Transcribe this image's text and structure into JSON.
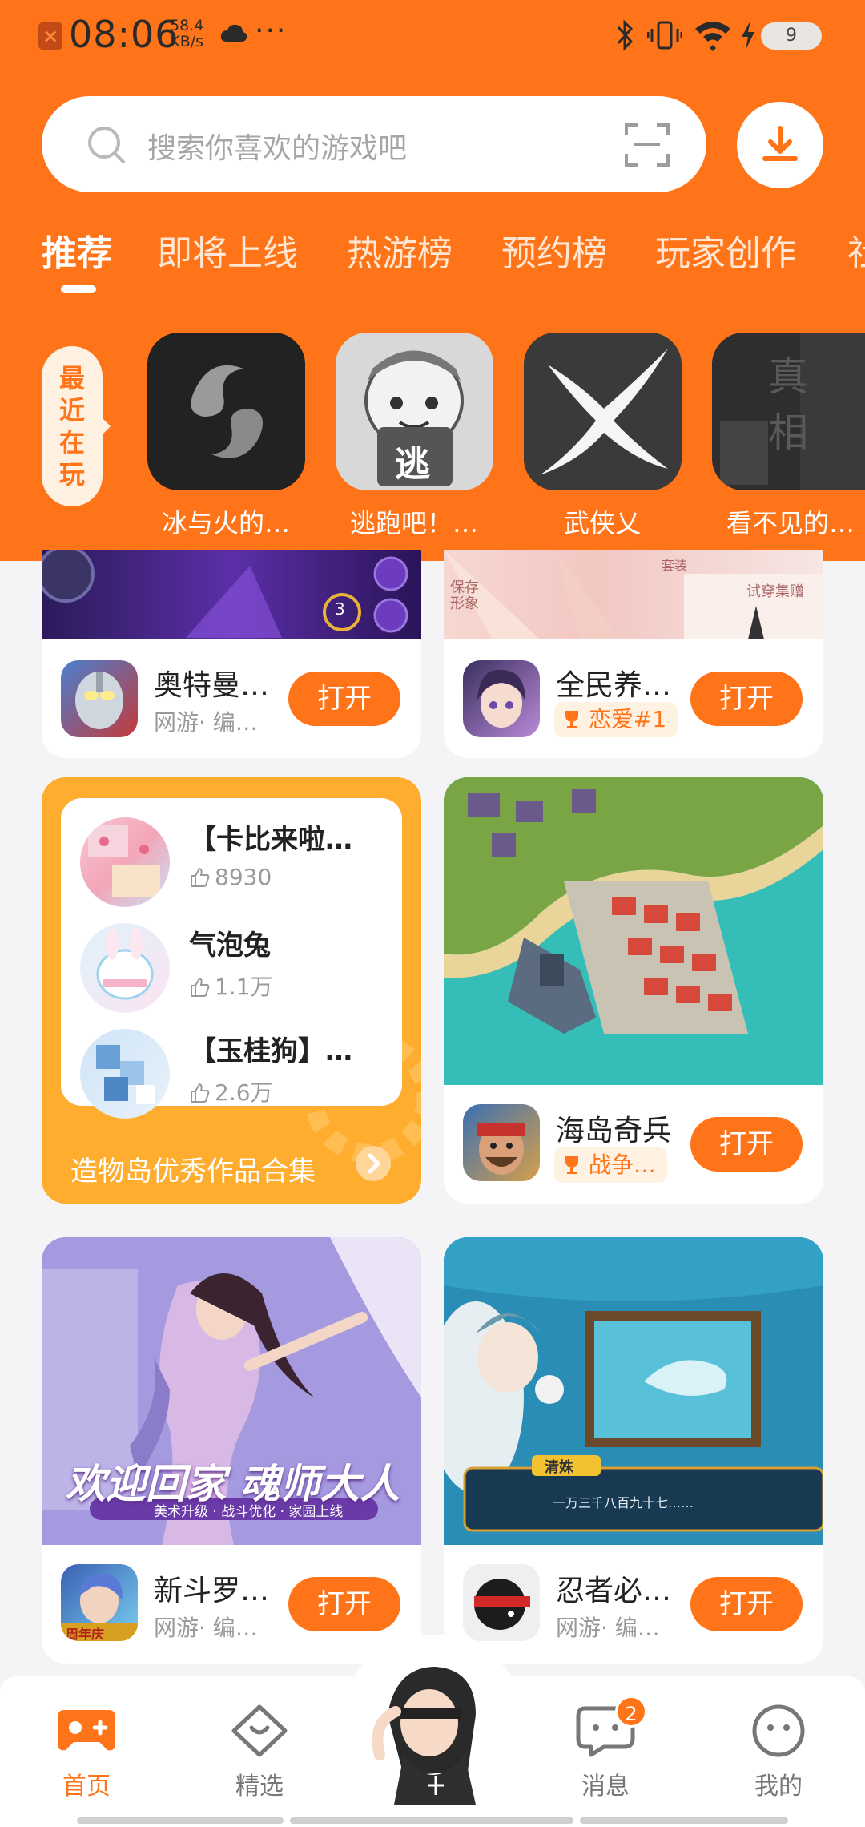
{
  "status_bar": {
    "time": "08:06",
    "speed_value": "58.4",
    "speed_unit": "KB/s",
    "more": "···",
    "battery": "9"
  },
  "search": {
    "placeholder": "搜索你喜欢的游戏吧"
  },
  "tabs": [
    {
      "label": "推荐",
      "active": true
    },
    {
      "label": "即将上线"
    },
    {
      "label": "热游榜"
    },
    {
      "label": "预约榜"
    },
    {
      "label": "玩家创作"
    },
    {
      "label": "社"
    }
  ],
  "recent": {
    "tag": "最近在玩",
    "games": [
      {
        "name": "冰与火的…"
      },
      {
        "name": "逃跑吧！…",
        "icon_text": "逃"
      },
      {
        "name": "武侠乂"
      },
      {
        "name": "看不见的…",
        "icon_text": "真相"
      }
    ]
  },
  "cards": {
    "ultraman": {
      "name": "奥特曼…",
      "sub": "网游· 编…",
      "button": "打开",
      "banner_badge": "3"
    },
    "quanmin": {
      "name": "全民养…",
      "badge": "恋爱#1",
      "button": "打开",
      "banner_texts": [
        "保存形象",
        "试穿集赠",
        "套装"
      ]
    },
    "haidao": {
      "name": "海岛奇兵",
      "badge": "战争…",
      "button": "打开"
    },
    "douluo": {
      "name": "新斗罗…",
      "sub": "网游· 编…",
      "button": "打开",
      "banner_title": "欢迎回家 魂师大人",
      "banner_sub": "美术升级 · 战斗优化 · 家园上线",
      "icon_text": "周年庆"
    },
    "ninja": {
      "name": "忍者必…",
      "sub": "网游· 编…",
      "button": "打开",
      "dialog_name": "清姝",
      "dialog_text": "一万三千八百九十七……"
    }
  },
  "collection": {
    "items": [
      {
        "title": "【卡比来啦…",
        "likes": "8930"
      },
      {
        "title": "气泡兔",
        "likes": "1.1万"
      },
      {
        "title": "【玉桂狗】…",
        "likes": "2.6万"
      }
    ],
    "footer": "造物岛优秀作品合集"
  },
  "nav": {
    "items": [
      {
        "label": "首页",
        "active": true
      },
      {
        "label": "精选"
      },
      {
        "label": "消息",
        "badge": "2"
      },
      {
        "label": "我的"
      }
    ]
  },
  "colors": {
    "accent": "#ff7419",
    "background": "#f4f4f6"
  }
}
